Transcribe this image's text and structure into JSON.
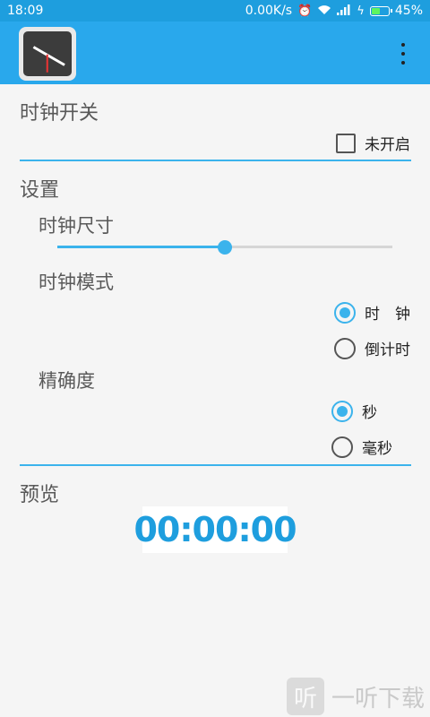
{
  "status_bar": {
    "time": "18:09",
    "speed": "0.00K/s",
    "battery_pct": "45%",
    "battery_level": 0.45,
    "icons": [
      "alarm-icon",
      "wifi-icon",
      "signal-icon",
      "charging-icon",
      "battery-icon"
    ]
  },
  "app_bar": {
    "icon": "clock-app-icon",
    "menu_icon": "overflow-menu-icon"
  },
  "sections": {
    "switch": {
      "title": "时钟开关",
      "checkbox_label": "未开启",
      "checked": false
    },
    "settings": {
      "title": "设置",
      "size": {
        "title": "时钟尺寸",
        "value_fraction": 0.5
      },
      "mode": {
        "title": "时钟模式",
        "options": [
          "时　钟",
          "倒计时"
        ],
        "selected": 0
      },
      "precision": {
        "title": "精确度",
        "options": [
          "秒",
          "毫秒"
        ],
        "selected": 0
      }
    },
    "preview": {
      "title": "预览",
      "display": "00:00:00"
    }
  },
  "watermark": {
    "icon_glyph": "听",
    "text": "一听下载"
  },
  "colors": {
    "accent": "#3bb3ec",
    "app_bar": "#29a8ec",
    "status_bar": "#1e9ede"
  }
}
